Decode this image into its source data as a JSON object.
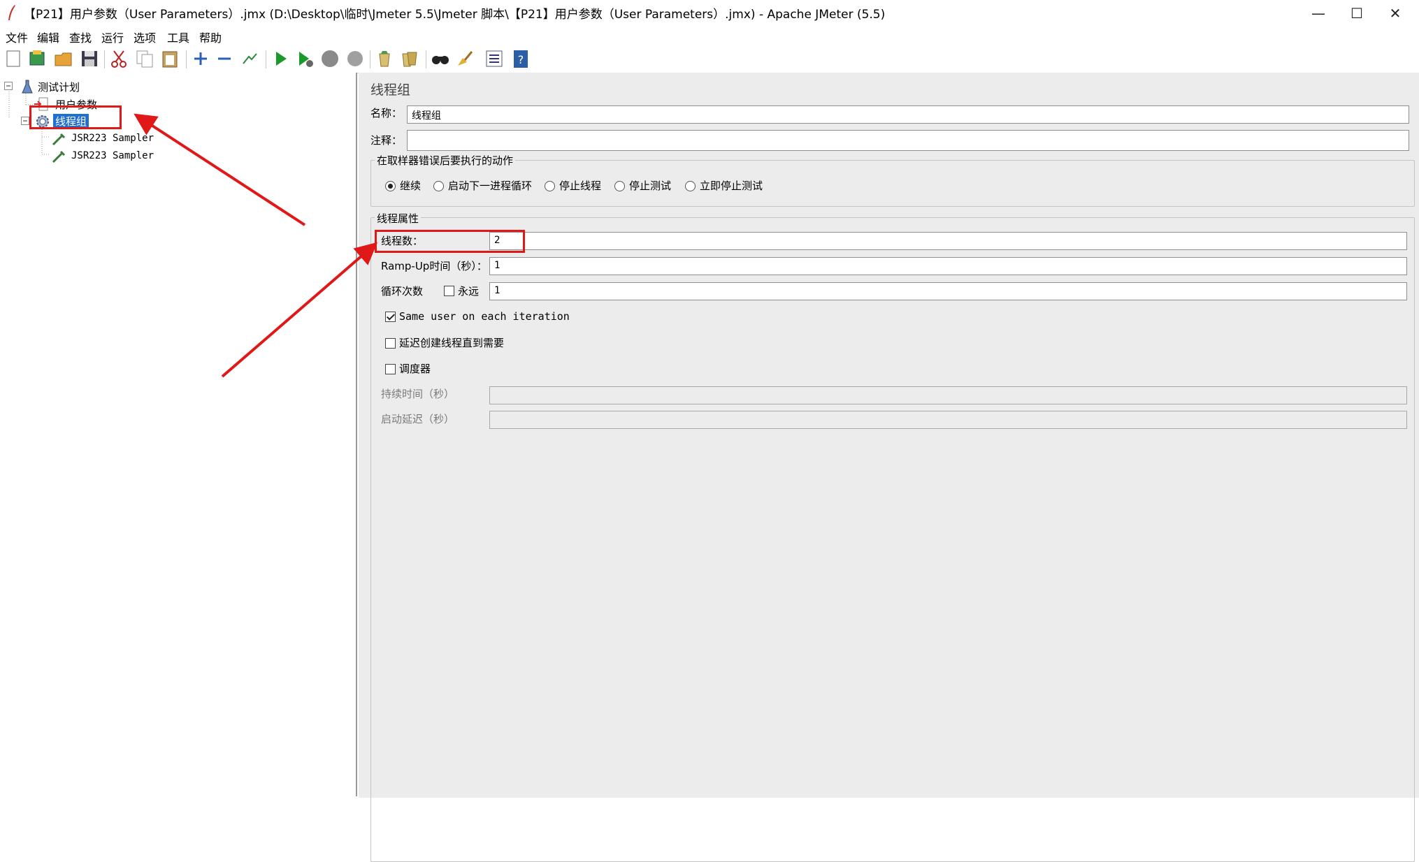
{
  "window": {
    "title": "【P21】用户参数（User Parameters）.jmx (D:\\Desktop\\临时\\Jmeter 5.5\\Jmeter 脚本\\【P21】用户参数（User Parameters）.jmx) - Apache JMeter (5.5)",
    "minimize": "—",
    "maximize": "☐",
    "close": "✕"
  },
  "menu": [
    "文件",
    "编辑",
    "查找",
    "运行",
    "选项",
    "工具",
    "帮助"
  ],
  "toolbar": [
    "new-icon",
    "templates-icon",
    "open-icon",
    "save-icon",
    "cut-icon",
    "copy-icon",
    "paste-icon",
    "expand-icon",
    "collapse-icon",
    "toggle-icon",
    "start-icon",
    "start-no-pause-icon",
    "stop-icon",
    "shutdown-icon",
    "clear-icon",
    "clear-all-icon",
    "search-icon",
    "reset-search-icon",
    "function-helper-icon",
    "help-icon"
  ],
  "tree": {
    "test_plan": "测试计划",
    "user_params": "用户参数",
    "thread_group": "线程组",
    "sampler1": "JSR223 Sampler",
    "sampler2": "JSR223 Sampler"
  },
  "panel": {
    "heading": "线程组",
    "name_label": "名称：",
    "name_value": "线程组",
    "comment_label": "注释：",
    "comment_value": "",
    "error_group_title": "在取样器错误后要执行的动作",
    "error_actions": [
      "继续",
      "启动下一进程循环",
      "停止线程",
      "停止测试",
      "立即停止测试"
    ],
    "selected_action": "继续",
    "thread_props_title": "线程属性",
    "threads_label": "线程数：",
    "threads_value": "2",
    "rampup_label": "Ramp-Up时间（秒）：",
    "rampup_value": "1",
    "loop_label": "循环次数",
    "forever_label": "永远",
    "forever_checked": false,
    "loop_value": "1",
    "same_user_label": "Same user on each iteration",
    "same_user_checked": true,
    "delay_label": "延迟创建线程直到需要",
    "delay_checked": false,
    "scheduler_label": "调度器",
    "scheduler_checked": false,
    "duration_label": "持续时间（秒）",
    "duration_value": "",
    "startup_delay_label": "启动延迟（秒）",
    "startup_delay_value": ""
  },
  "annotation_color": "#e01818"
}
